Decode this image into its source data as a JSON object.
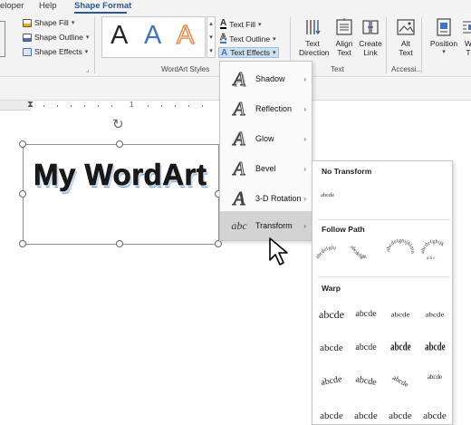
{
  "tabs": [
    {
      "label": "eloper",
      "active": false
    },
    {
      "label": "Help",
      "active": false
    },
    {
      "label": "Shape Format",
      "active": true
    }
  ],
  "ribbon": {
    "shape_fill": "Shape Fill",
    "shape_outline": "Shape Outline",
    "shape_effects": "Shape Effects",
    "wordart_letters": [
      "A",
      "A",
      "A"
    ],
    "wordart_colors": [
      "#000000",
      "#4472c4",
      "#ed7d31"
    ],
    "text_fill": "Text Fill",
    "text_outline": "Text Outline",
    "text_effects": "Text Effects",
    "wordart_styles_label": "WordArt Styles",
    "text_direction": "Text\nDirection",
    "align_text": "Align\nText",
    "create_link": "Create\nLink",
    "text_group_label": "Text",
    "alt_text": "Alt\nText",
    "accessibility_label": "Accessi...",
    "position": "Position",
    "wrap_text": "W\nT"
  },
  "ruler": {
    "mark": "1"
  },
  "document": {
    "wordart_text": "My WordArt"
  },
  "text_effects_menu": {
    "items": [
      {
        "label": "Shadow",
        "icon": "shadow-icon",
        "active": false
      },
      {
        "label": "Reflection",
        "icon": "reflection-icon",
        "active": false
      },
      {
        "label": "Glow",
        "icon": "glow-icon",
        "active": false
      },
      {
        "label": "Bevel",
        "icon": "bevel-icon",
        "active": false
      },
      {
        "label": "3-D Rotation",
        "icon": "3d-rotation-icon",
        "active": false
      },
      {
        "label": "Transform",
        "icon": "transform-icon",
        "active": true
      }
    ],
    "icon_glyphs": [
      "A",
      "A",
      "A",
      "A",
      "A",
      "abc"
    ]
  },
  "transform_menu": {
    "no_transform_heading": "No Transform",
    "no_transform_sample": "abcde",
    "follow_path_heading": "Follow Path",
    "warp_heading": "Warp",
    "warp_sample": "abcde"
  },
  "colors": {
    "accent": "#2b579a",
    "menu_hover": "#d3d3d3"
  }
}
